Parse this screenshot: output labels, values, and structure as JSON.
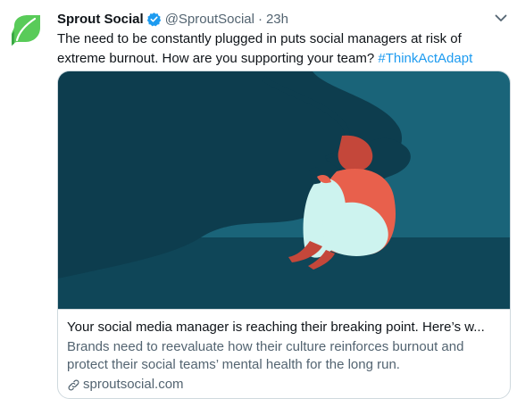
{
  "tweet": {
    "author_name": "Sprout Social",
    "handle": "@SproutSocial",
    "separator": "·",
    "time": "23h",
    "text_main": "The need to be constantly plugged in puts social managers at risk of extreme burnout. How are you supporting your team? ",
    "hashtag": "#ThinkActAdapt"
  },
  "card": {
    "title": "Your social media manager is reaching their breaking point. Here’s w...",
    "description": "Brands need to reevaluate how their culture reinforces burnout and protect their social teams’ mental health for the long run.",
    "domain": "sproutsocial.com"
  },
  "icons": {
    "avatar": "sprout-leaf-logo",
    "verified": "verified-badge-icon",
    "caret": "chevron-down-icon",
    "link": "link-icon"
  },
  "colors": {
    "brand_green": "#59cb59",
    "link_blue": "#1d9bf0",
    "muted_text": "#536471",
    "scene_dark": "#0d3d4e",
    "scene_teal": "#1a6479",
    "figure_coral": "#e8604c",
    "figure_light": "#cdf3ef"
  }
}
